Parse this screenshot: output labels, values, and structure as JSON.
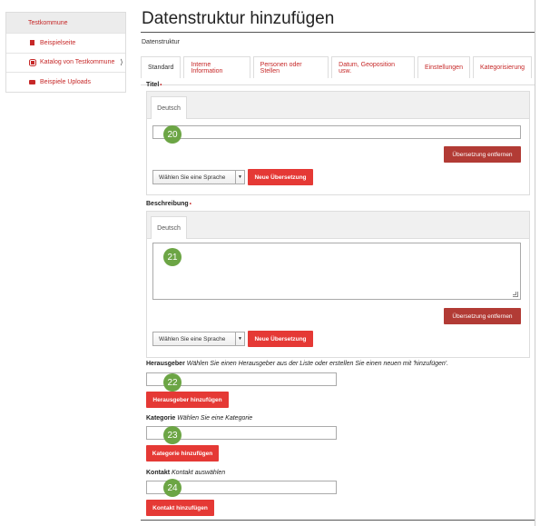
{
  "sidebar": {
    "items": [
      {
        "label": "Testkommune",
        "icon": "none"
      },
      {
        "label": "Beispielseite",
        "icon": "document-icon"
      },
      {
        "label": "Katalog von Testkommune",
        "icon": "database-icon",
        "chevron": "⟩"
      },
      {
        "label": "Beispiele Uploads",
        "icon": "folder-icon"
      }
    ]
  },
  "page": {
    "title": "Datenstruktur hinzufügen",
    "section": "Datenstruktur"
  },
  "tabs": [
    {
      "label": "Standard"
    },
    {
      "label": "Interne Information"
    },
    {
      "label": "Personen oder Stellen"
    },
    {
      "label": "Datum, Geoposition usw."
    },
    {
      "label": "Einstellungen"
    },
    {
      "label": "Kategorisierung"
    }
  ],
  "titel": {
    "label": "Titel",
    "required_marker": "•",
    "lang_tab": "Deutsch",
    "value": "",
    "remove_translation": "Übersetzung entfernen",
    "select_language": "Wählen Sie eine Sprache",
    "new_translation": "Neue Übersetzung"
  },
  "beschreibung": {
    "label": "Beschreibung",
    "required_marker": "•",
    "lang_tab": "Deutsch",
    "value": "",
    "remove_translation": "Übersetzung entfernen",
    "select_language": "Wählen Sie eine Sprache",
    "new_translation": "Neue Übersetzung"
  },
  "herausgeber": {
    "label": "Herausgeber",
    "help": "Wählen Sie einen Herausgeber aus der Liste oder erstellen Sie einen neuen mit 'hinzufügen'.",
    "value": "",
    "button": "Herausgeber hinzufügen"
  },
  "kategorie": {
    "label": "Kategorie",
    "help": "Wählen Sie eine Kategorie",
    "value": "",
    "button": "Kategorie hinzufügen"
  },
  "kontakt": {
    "label": "Kontakt",
    "help": "Kontakt auswählen",
    "value": "",
    "button": "Kontakt hinzufügen"
  },
  "badges": [
    "20",
    "21",
    "22",
    "23",
    "24"
  ],
  "colors": {
    "accent": "#c62828",
    "button": "#e53935",
    "button_dark": "#b23b35",
    "badge": "#6ca545"
  }
}
